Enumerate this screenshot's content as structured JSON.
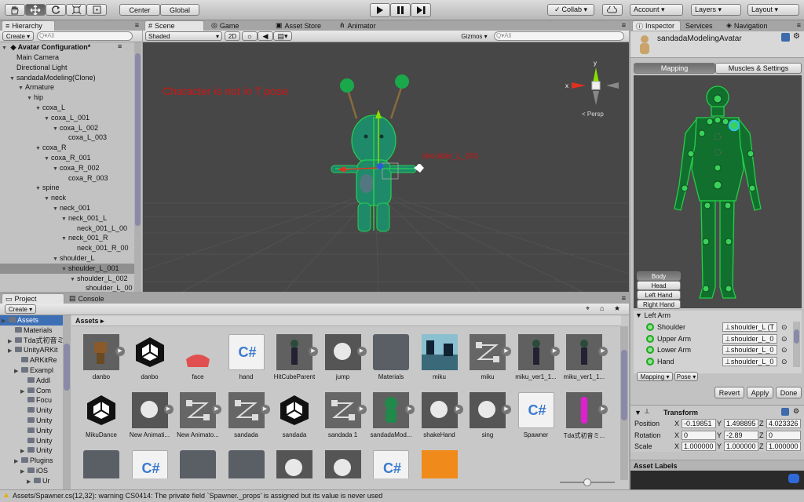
{
  "toolbar": {
    "center_label": "Center",
    "global_label": "Global",
    "collab_label": "Collab ▾",
    "account_label": "Account ▾",
    "layers_label": "Layers ▾",
    "layout_label": "Layout ▾"
  },
  "hierarchy": {
    "tab": "Hierarchy",
    "create": "Create ▾",
    "search_placeholder": "Q▾All",
    "scene_name": "Avatar Configuration*",
    "rows": [
      {
        "label": "Main Camera",
        "indent": 0,
        "arrow": false
      },
      {
        "label": "Directional Light",
        "indent": 0,
        "arrow": false
      },
      {
        "label": "sandadaModeling(Clone)",
        "indent": 0,
        "arrow": true
      },
      {
        "label": "Armature",
        "indent": 1,
        "arrow": true
      },
      {
        "label": "hip",
        "indent": 2,
        "arrow": true
      },
      {
        "label": "coxa_L",
        "indent": 3,
        "arrow": true
      },
      {
        "label": "coxa_L_001",
        "indent": 4,
        "arrow": true
      },
      {
        "label": "coxa_L_002",
        "indent": 5,
        "arrow": true
      },
      {
        "label": "coxa_L_003",
        "indent": 6,
        "arrow": false
      },
      {
        "label": "coxa_R",
        "indent": 3,
        "arrow": true
      },
      {
        "label": "coxa_R_001",
        "indent": 4,
        "arrow": true
      },
      {
        "label": "coxa_R_002",
        "indent": 5,
        "arrow": true
      },
      {
        "label": "coxa_R_003",
        "indent": 6,
        "arrow": false
      },
      {
        "label": "spine",
        "indent": 3,
        "arrow": true
      },
      {
        "label": "neck",
        "indent": 4,
        "arrow": true
      },
      {
        "label": "neck_001",
        "indent": 5,
        "arrow": true
      },
      {
        "label": "neck_001_L",
        "indent": 6,
        "arrow": true
      },
      {
        "label": "neck_001_L_00",
        "indent": 7,
        "arrow": false
      },
      {
        "label": "neck_001_R",
        "indent": 6,
        "arrow": true
      },
      {
        "label": "neck_001_R_00",
        "indent": 7,
        "arrow": false
      },
      {
        "label": "shoulder_L",
        "indent": 5,
        "arrow": true
      },
      {
        "label": "shoulder_L_001",
        "indent": 6,
        "arrow": true,
        "selected": true
      },
      {
        "label": "shoulder_L_002",
        "indent": 7,
        "arrow": true
      },
      {
        "label": "shoulder_L_00",
        "indent": 8,
        "arrow": false
      }
    ]
  },
  "scene": {
    "tabs": {
      "scene": "Scene",
      "game": "Game",
      "asset_store": "Asset Store",
      "animator": "Animator"
    },
    "shaded": "Shaded",
    "mode_2d": "2D",
    "gizmos": "Gizmos ▾",
    "search_placeholder": "Q▾All",
    "warning": "Character is not in T pose",
    "bone_label": "shoulder_L_001",
    "persp": "< Persp",
    "axis_x": "x",
    "axis_y": "y"
  },
  "project": {
    "tabs": {
      "project": "Project",
      "console": "Console"
    },
    "create": "Create ▾",
    "breadcrumb": "Assets ▸",
    "tree": [
      {
        "label": "Assets",
        "indent": 0,
        "arrow": true,
        "selected": true
      },
      {
        "label": "Materials",
        "indent": 1,
        "arrow": false
      },
      {
        "label": "Tda式初音ミ",
        "indent": 1,
        "arrow": true
      },
      {
        "label": "UnityARKit",
        "indent": 1,
        "arrow": true
      },
      {
        "label": "ARKitRe",
        "indent": 2,
        "arrow": false
      },
      {
        "label": "Exampl",
        "indent": 2,
        "arrow": true
      },
      {
        "label": "Addl",
        "indent": 3,
        "arrow": false
      },
      {
        "label": "Com",
        "indent": 3,
        "arrow": true
      },
      {
        "label": "Focu",
        "indent": 3,
        "arrow": false
      },
      {
        "label": "Unity",
        "indent": 3,
        "arrow": false
      },
      {
        "label": "Unity",
        "indent": 3,
        "arrow": false
      },
      {
        "label": "Unity",
        "indent": 3,
        "arrow": false
      },
      {
        "label": "Unity",
        "indent": 3,
        "arrow": false
      },
      {
        "label": "Unity",
        "indent": 3,
        "arrow": true
      },
      {
        "label": "Plugins",
        "indent": 2,
        "arrow": true
      },
      {
        "label": "iOS",
        "indent": 3,
        "arrow": true
      },
      {
        "label": "Ur",
        "indent": 4,
        "arrow": true
      }
    ],
    "assets_row1": [
      {
        "name": "danbo",
        "icon": "prefab-brown"
      },
      {
        "name": "danbo",
        "icon": "unity"
      },
      {
        "name": "face",
        "icon": "face"
      },
      {
        "name": "hand",
        "icon": "cs"
      },
      {
        "name": "HitCubeParent",
        "icon": "prefab-dark"
      },
      {
        "name": "jump",
        "icon": "movie"
      },
      {
        "name": "Materials",
        "icon": "folder"
      },
      {
        "name": "miku",
        "icon": "miku-thumb"
      },
      {
        "name": "miku",
        "icon": "anim"
      },
      {
        "name": "miku_ver1_1...",
        "icon": "prefab-dark"
      },
      {
        "name": "miku_ver1_1...",
        "icon": "prefab-dark"
      }
    ],
    "assets_row2": [
      {
        "name": "MikuDance",
        "icon": "unity"
      },
      {
        "name": "New Animati...",
        "icon": "movie"
      },
      {
        "name": "New Animato...",
        "icon": "anim"
      },
      {
        "name": "sandada",
        "icon": "anim"
      },
      {
        "name": "sandada",
        "icon": "unity"
      },
      {
        "name": "sandada 1",
        "icon": "anim"
      },
      {
        "name": "sandadaMod...",
        "icon": "green"
      },
      {
        "name": "shakeHand",
        "icon": "movie"
      },
      {
        "name": "sing",
        "icon": "movie"
      },
      {
        "name": "Spawner",
        "icon": "cs"
      },
      {
        "name": "Tda式初音ミ...",
        "icon": "magenta"
      }
    ],
    "assets_row3": [
      "folder",
      "cs",
      "folder",
      "folder",
      "movie",
      "movie",
      "cs",
      "orange"
    ]
  },
  "inspector": {
    "tabs": {
      "inspector": "Inspector",
      "services": "Services",
      "navigation": "Navigation"
    },
    "object_name": "sandadaModelingAvatar",
    "mapping_tab": "Mapping",
    "muscles_tab": "Muscles & Settings",
    "body_buttons": [
      "Body",
      "Head",
      "Left Hand",
      "Right Hand"
    ],
    "section": "Left Arm",
    "bones": [
      {
        "label": "Shoulder",
        "value": "⊥shoulder_L (T"
      },
      {
        "label": "Upper Arm",
        "value": "⊥shoulder_L_0"
      },
      {
        "label": "Lower Arm",
        "value": "⊥shoulder_L_0"
      },
      {
        "label": "Hand",
        "value": "⊥shoulder_L_0"
      }
    ],
    "mapping_dropdown": "Mapping ▾",
    "pose_dropdown": "Pose ▾",
    "revert": "Revert",
    "apply": "Apply",
    "done": "Done",
    "transform": {
      "title": "Transform",
      "rows": [
        {
          "label": "Position",
          "x": "-0.19851",
          "y": "1.498895",
          "z": "4.023326"
        },
        {
          "label": "Rotation",
          "x": "0",
          "y": "-2.89",
          "z": "0"
        },
        {
          "label": "Scale",
          "x": "1.000000",
          "y": "1.000000",
          "z": "1.000000"
        }
      ]
    },
    "asset_labels": "Asset Labels"
  },
  "status": {
    "message": "Assets/Spawner.cs(12,32): warning CS0414: The private field `Spawner._props' is assigned but its value is never used"
  }
}
